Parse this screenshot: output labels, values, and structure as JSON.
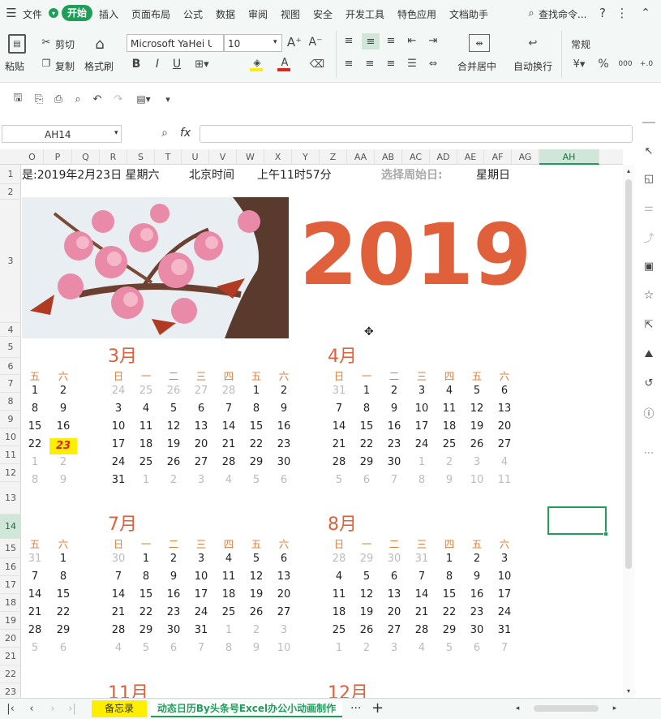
{
  "menu": {
    "file": "文件",
    "start": "开始",
    "items": [
      "插入",
      "页面布局",
      "公式",
      "数据",
      "审阅",
      "视图",
      "安全",
      "开发工具",
      "特色应用",
      "文档助手"
    ],
    "search": "查找命令..."
  },
  "ribbon": {
    "paste": "粘贴",
    "cut": "剪切",
    "copy": "复制",
    "format_painter": "格式刷",
    "font_name": "Microsoft YaHei U",
    "font_size": "10",
    "merge": "合并居中",
    "wrap": "自动换行",
    "number_format": "常规"
  },
  "formula": {
    "cell_ref": "AH14",
    "fx": "fx",
    "value": ""
  },
  "columns": [
    "O",
    "P",
    "Q",
    "R",
    "S",
    "T",
    "U",
    "V",
    "W",
    "X",
    "Y",
    "Z",
    "AA",
    "AB",
    "AC",
    "AD",
    "AE",
    "AF",
    "AG",
    "AH"
  ],
  "rows": [
    "1",
    "2",
    "3",
    "4",
    "5",
    "6",
    "7",
    "8",
    "9",
    "10",
    "11",
    "12",
    "13",
    "14",
    "15",
    "16",
    "17",
    "18",
    "19",
    "20",
    "21",
    "22",
    "23"
  ],
  "header_line": {
    "today": "是:2019年2月23日  星期六",
    "beijing": "北京时间",
    "time": "上午11时57分",
    "start_label": "选择周始日:",
    "start_value": "星期日"
  },
  "year": "2019",
  "months": {
    "m3": "3月",
    "m4": "4月",
    "m7": "7月",
    "m8": "8月",
    "m11": "11月",
    "m12": "12月"
  },
  "weekday_full": [
    "日",
    "一",
    "二",
    "三",
    "四",
    "五",
    "六"
  ],
  "weekday_partial": [
    "五",
    "六"
  ],
  "left_partial": {
    "block1": [
      [
        "1",
        "2"
      ],
      [
        "8",
        "9"
      ],
      [
        "15",
        "16"
      ],
      [
        "22",
        "23"
      ],
      [
        "1",
        "2"
      ],
      [
        "8",
        "9"
      ]
    ],
    "block2": [
      [
        "31",
        "1"
      ],
      [
        "7",
        "8"
      ],
      [
        "14",
        "15"
      ],
      [
        "21",
        "22"
      ],
      [
        "28",
        "29"
      ],
      [
        "5",
        "6"
      ]
    ]
  },
  "cal": {
    "march": [
      [
        "24",
        "25",
        "26",
        "27",
        "28",
        "1",
        "2"
      ],
      [
        "3",
        "4",
        "5",
        "6",
        "7",
        "8",
        "9"
      ],
      [
        "10",
        "11",
        "12",
        "13",
        "14",
        "15",
        "16"
      ],
      [
        "17",
        "18",
        "19",
        "20",
        "21",
        "22",
        "23"
      ],
      [
        "24",
        "25",
        "26",
        "27",
        "28",
        "29",
        "30"
      ],
      [
        "31",
        "1",
        "2",
        "3",
        "4",
        "5",
        "6"
      ]
    ],
    "april": [
      [
        "31",
        "1",
        "2",
        "3",
        "4",
        "5",
        "6"
      ],
      [
        "7",
        "8",
        "9",
        "10",
        "11",
        "12",
        "13"
      ],
      [
        "14",
        "15",
        "16",
        "17",
        "18",
        "19",
        "20"
      ],
      [
        "21",
        "22",
        "23",
        "24",
        "25",
        "26",
        "27"
      ],
      [
        "28",
        "29",
        "30",
        "1",
        "2",
        "3",
        "4"
      ],
      [
        "5",
        "6",
        "7",
        "8",
        "9",
        "10",
        "11"
      ]
    ],
    "july": [
      [
        "30",
        "1",
        "2",
        "3",
        "4",
        "5",
        "6"
      ],
      [
        "7",
        "8",
        "9",
        "10",
        "11",
        "12",
        "13"
      ],
      [
        "14",
        "15",
        "16",
        "17",
        "18",
        "19",
        "20"
      ],
      [
        "21",
        "22",
        "23",
        "24",
        "25",
        "26",
        "27"
      ],
      [
        "28",
        "29",
        "30",
        "31",
        "1",
        "2",
        "3"
      ],
      [
        "4",
        "5",
        "6",
        "7",
        "8",
        "9",
        "10"
      ]
    ],
    "august": [
      [
        "28",
        "29",
        "30",
        "31",
        "1",
        "2",
        "3"
      ],
      [
        "4",
        "5",
        "6",
        "7",
        "8",
        "9",
        "10"
      ],
      [
        "11",
        "12",
        "13",
        "14",
        "15",
        "16",
        "17"
      ],
      [
        "18",
        "19",
        "20",
        "21",
        "22",
        "23",
        "24"
      ],
      [
        "25",
        "26",
        "27",
        "28",
        "29",
        "30",
        "31"
      ],
      [
        "1",
        "2",
        "3",
        "4",
        "5",
        "6",
        "7"
      ]
    ]
  },
  "tabs": {
    "memo": "备忘录",
    "active": "动态日历By头条号Excel办公小动画制作",
    "more": "···",
    "add": "+"
  },
  "colors": {
    "accent": "#1f9e5a",
    "orange": "#e0603b",
    "weekday": "#e07e3a",
    "highlight": "#ffee00"
  }
}
